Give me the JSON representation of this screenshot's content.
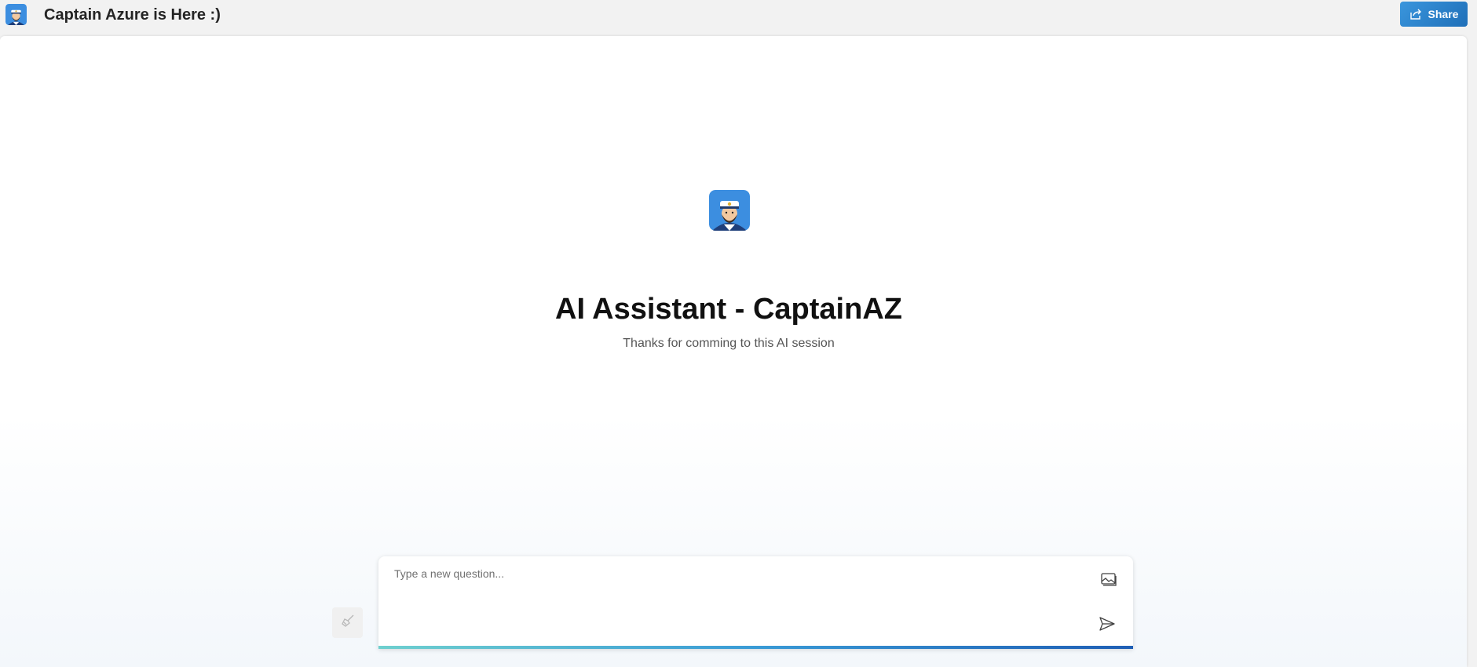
{
  "header": {
    "logo_icon": "captain-avatar-icon",
    "title": "Captain Azure is Here :)",
    "share_label": "Share",
    "share_icon": "share-icon"
  },
  "hero": {
    "avatar_icon": "captain-avatar-icon",
    "title": "AI Assistant - CaptainAZ",
    "subtitle": "Thanks for comming to this AI session"
  },
  "composer": {
    "placeholder": "Type a new question...",
    "value": "",
    "clear_icon": "broom-icon",
    "image_icon": "image-icon",
    "send_icon": "send-icon"
  },
  "colors": {
    "share_button": "#2b83cf",
    "accent_start": "#6fd0cf",
    "accent_end": "#1f5fb5"
  }
}
